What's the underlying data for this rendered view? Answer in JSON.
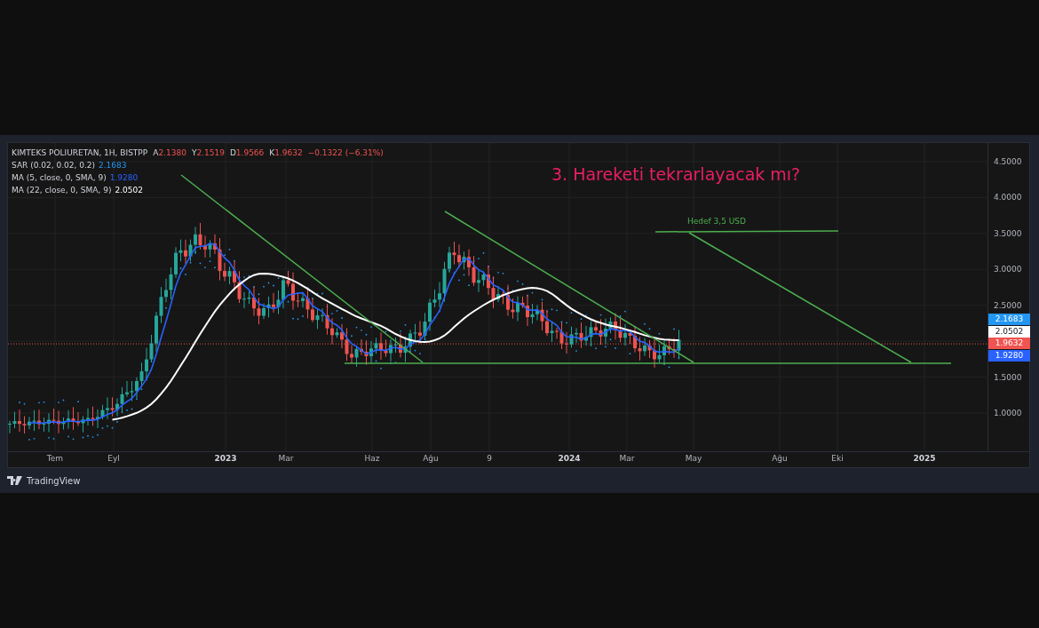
{
  "legend": {
    "title": "KIMTEKS POLIURETAN, 1H, BISTPP",
    "ohlc": [
      {
        "label": "A",
        "value": "2.1380"
      },
      {
        "label": "Y",
        "value": "2.1519"
      },
      {
        "label": "D",
        "value": "1.9566"
      },
      {
        "label": "K",
        "value": "1.9632"
      }
    ],
    "change": "−0.1322 (−6.31%)",
    "indicators": [
      {
        "label": "SAR (0.02, 0.02, 0.2)",
        "value": "2.1683"
      },
      {
        "label": "MA (5, close, 0, SMA, 9)",
        "value": "1.9280"
      },
      {
        "label": "MA (22, close, 0, SMA, 9)",
        "value": "2.0502"
      }
    ]
  },
  "annotations": {
    "headline": "3. Hareketi tekrarlayacak mı?",
    "target_label": "Hedef 3,5 USD"
  },
  "price_axis": {
    "ticks": [
      "4.5000",
      "4.0000",
      "3.5000",
      "3.0000",
      "2.5000",
      "1.5000",
      "1.0000"
    ],
    "price_tags": [
      {
        "value": "2.1683",
        "color": "#2196f3"
      },
      {
        "value": "2.0502",
        "color": "#ffffff"
      },
      {
        "value": "1.9632",
        "color": "#f05350"
      },
      {
        "value": "1.9280",
        "color": "#2962ff"
      }
    ]
  },
  "time_axis": [
    {
      "label": "Tem",
      "kind": "month"
    },
    {
      "label": "Eyl",
      "kind": "month"
    },
    {
      "label": "2023",
      "kind": "year"
    },
    {
      "label": "Mar",
      "kind": "month"
    },
    {
      "label": "Haz",
      "kind": "month"
    },
    {
      "label": "Ağu",
      "kind": "month"
    },
    {
      "label": "9",
      "kind": "month"
    },
    {
      "label": "2024",
      "kind": "year"
    },
    {
      "label": "Mar",
      "kind": "month"
    },
    {
      "label": "May",
      "kind": "month"
    },
    {
      "label": "Ağu",
      "kind": "month"
    },
    {
      "label": "Eki",
      "kind": "month"
    },
    {
      "label": "2025",
      "kind": "year"
    }
  ],
  "footer": {
    "brand": "TradingView"
  }
}
